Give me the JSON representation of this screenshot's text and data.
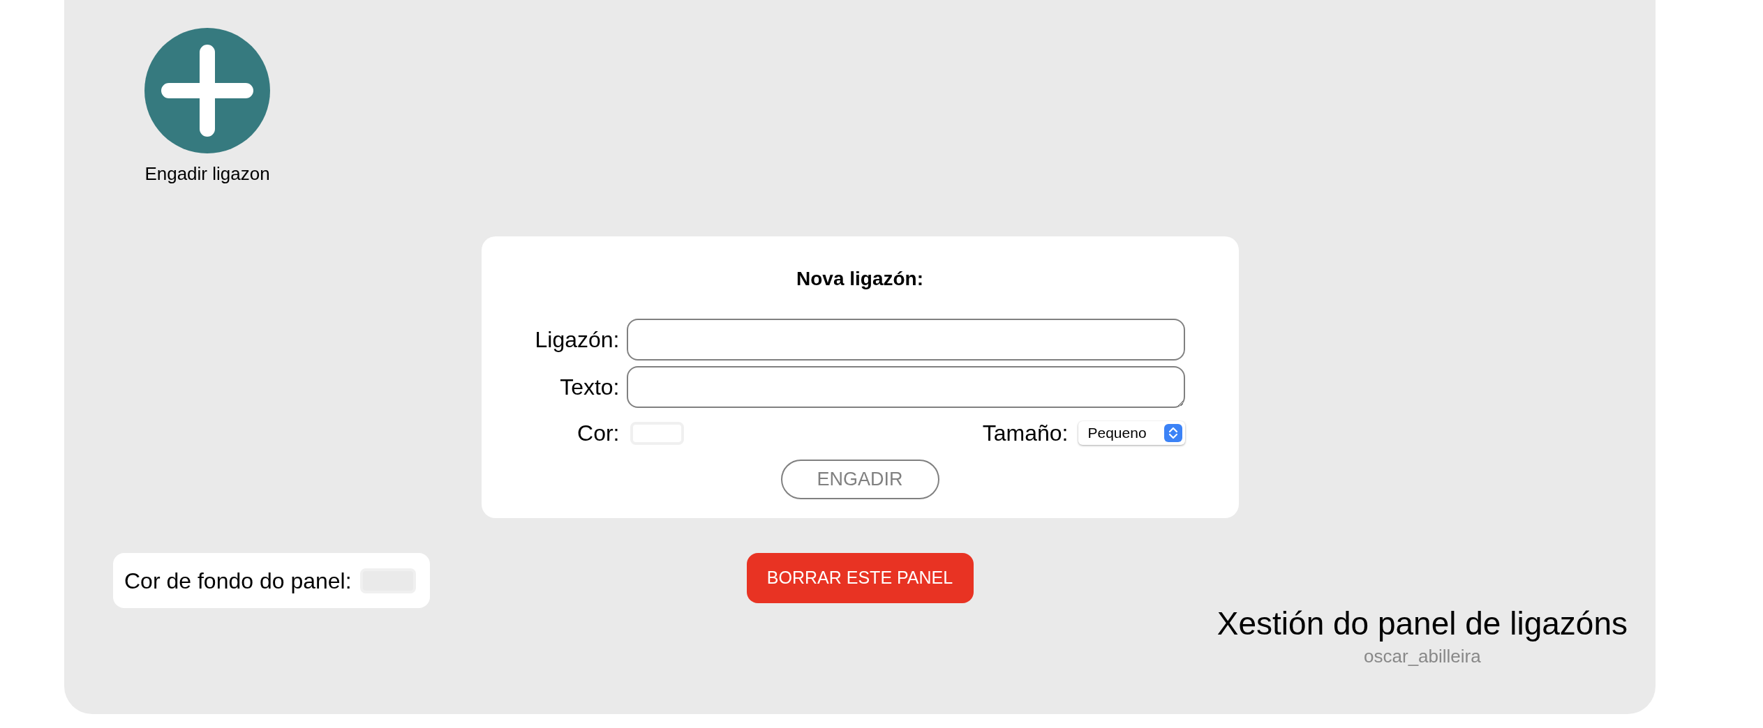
{
  "add_link": {
    "label": "Engadir ligazon"
  },
  "form": {
    "title": "Nova ligazón:",
    "fields": [
      {
        "label": "Ligazón:",
        "kind": "input"
      },
      {
        "label": "Texto:",
        "kind": "textarea"
      }
    ],
    "color_label": "Cor:",
    "size_label": "Tamaño:",
    "size_value": "Pequeno",
    "submit": "ENGADIR"
  },
  "panel_color": {
    "label": "Cor de fondo do panel:"
  },
  "delete_button": "BORRAR ESTE PANEL",
  "footer": {
    "title": "Xestión do panel de ligazóns",
    "author": "oscar_abilleira"
  }
}
